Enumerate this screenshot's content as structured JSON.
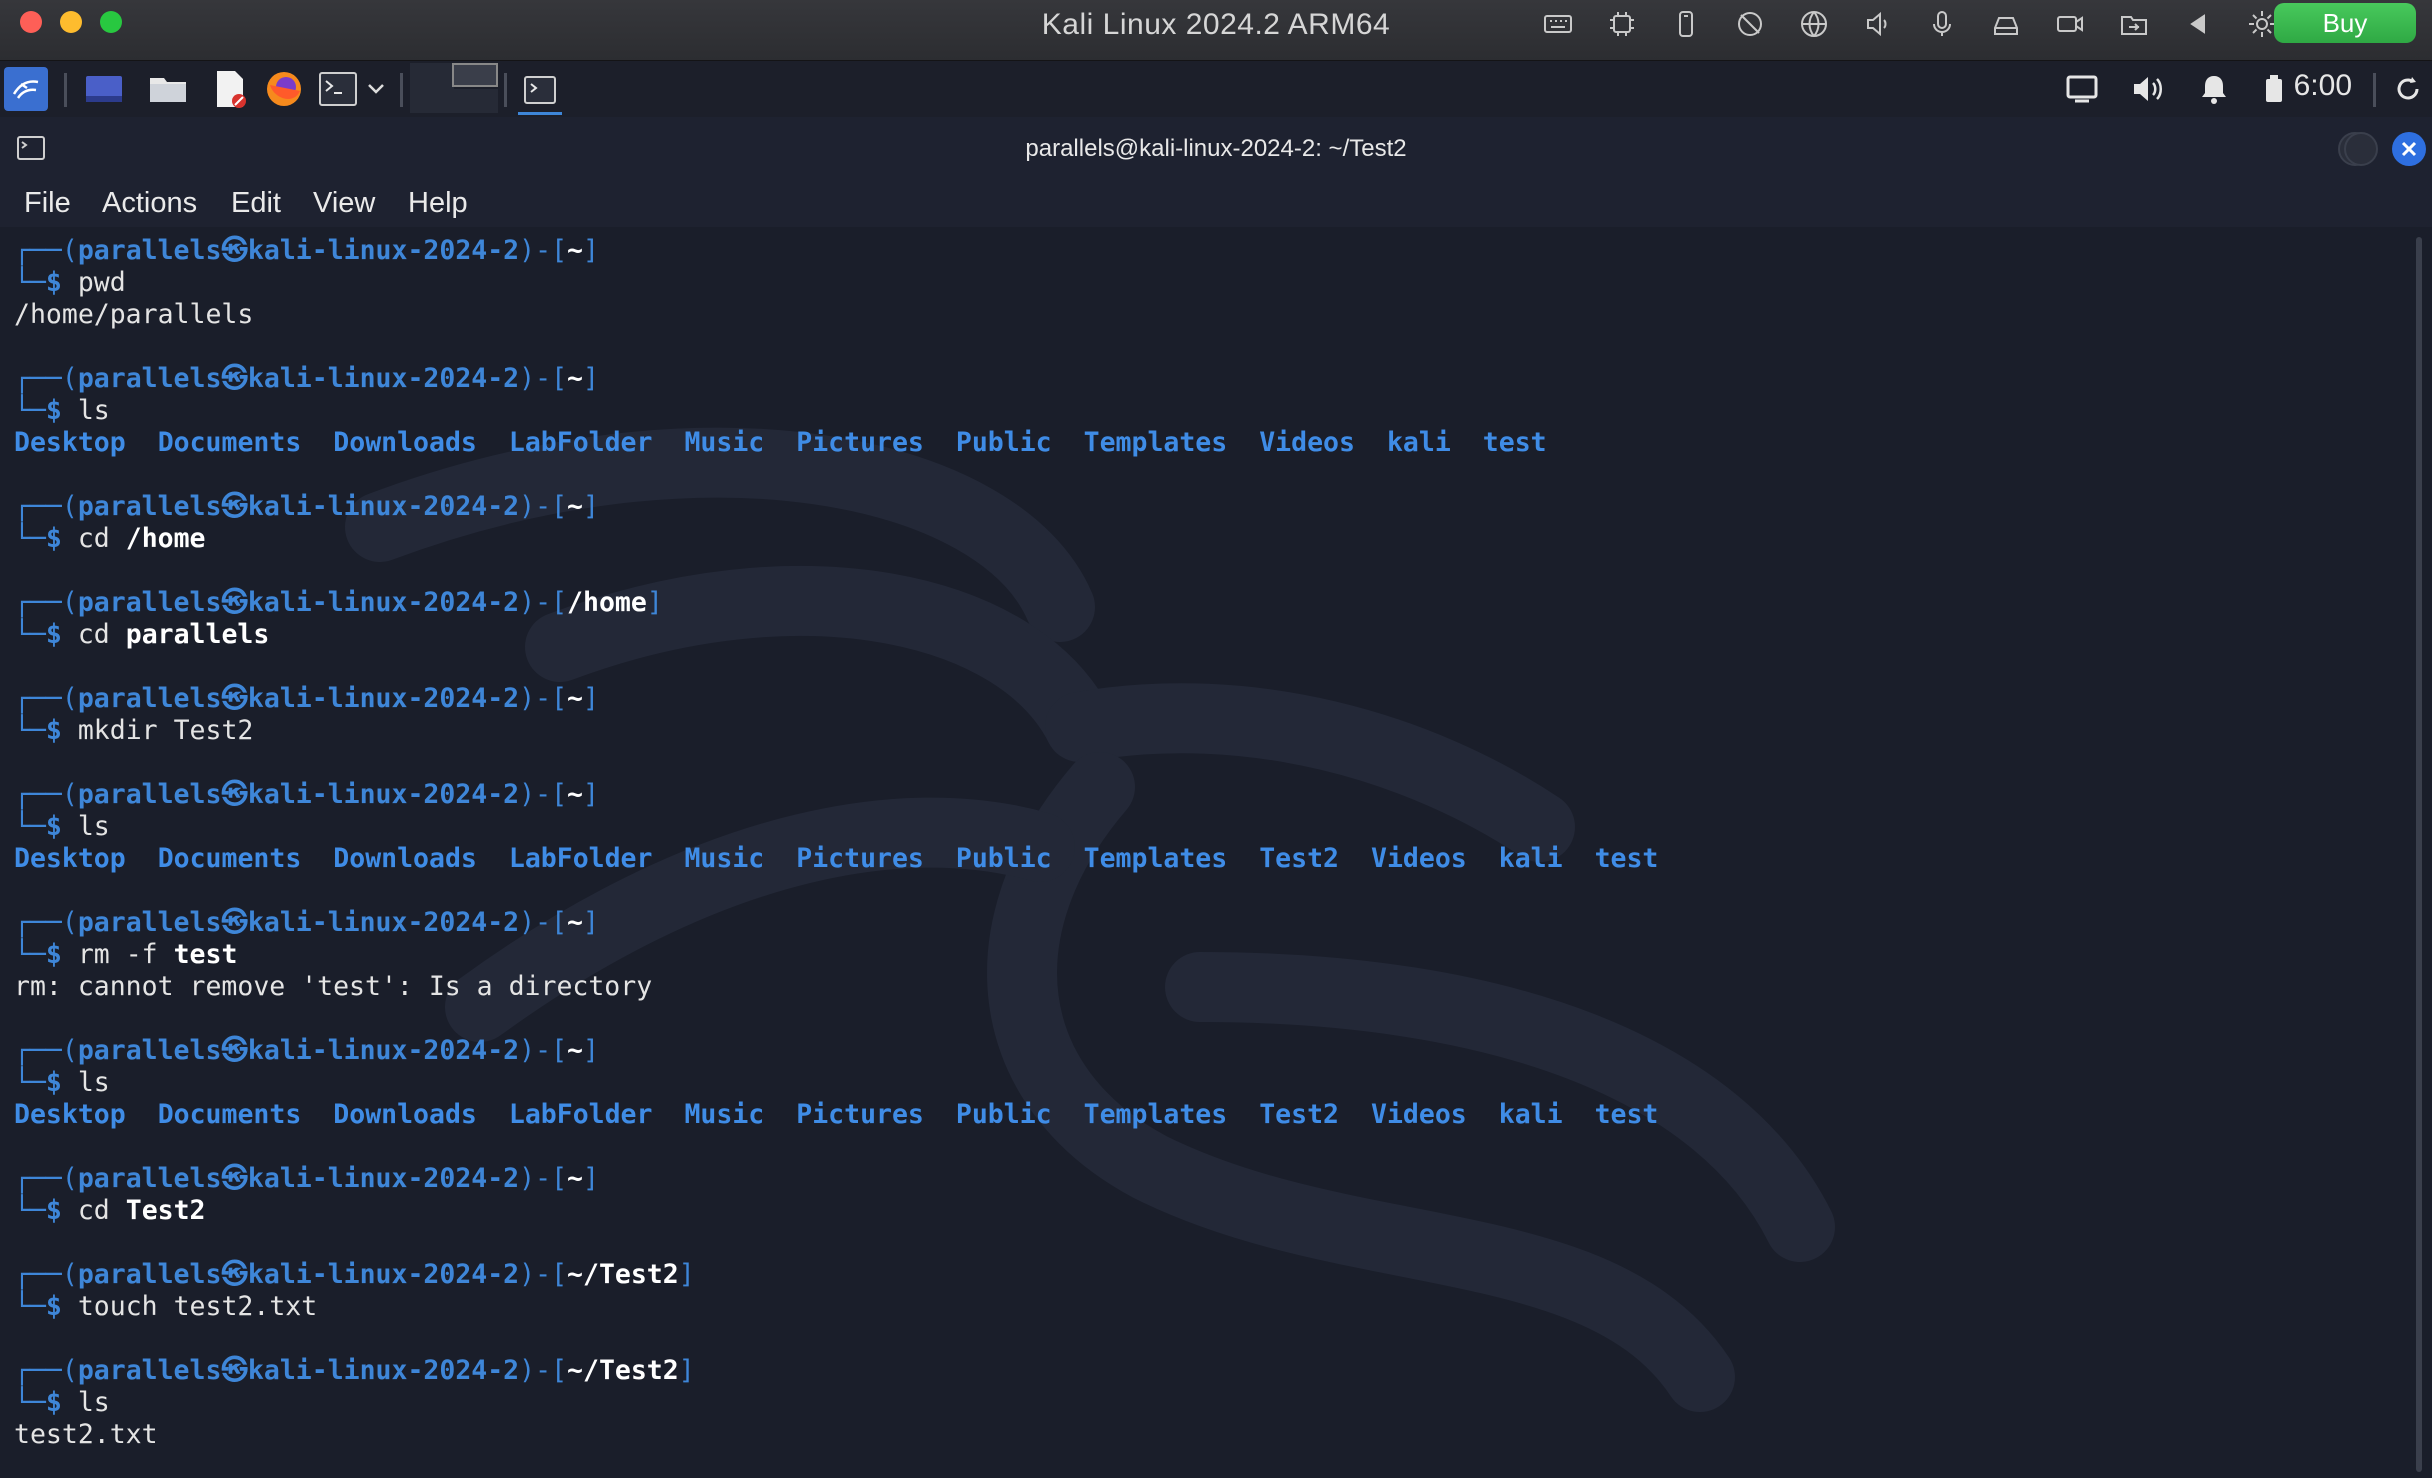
{
  "mac": {
    "title": "Kali Linux 2024.2 ARM64",
    "buy_label": "Buy",
    "icons": [
      "keyboard-icon",
      "cpu-icon",
      "usb-icon",
      "camera-off-icon",
      "globe-icon",
      "speaker-icon",
      "microphone-icon",
      "drive-icon",
      "video-icon",
      "shared-folder-icon",
      "back-arrow-icon",
      "gear-icon"
    ]
  },
  "panel": {
    "clock": "6:00"
  },
  "window": {
    "title": "parallels@kali-linux-2024-2: ~/Test2"
  },
  "menu": [
    "File",
    "Actions",
    "Edit",
    "View",
    "Help"
  ],
  "terminal": {
    "user": "parallels",
    "host": "kali-linux-2024-2",
    "blocks": [
      {
        "path": "~",
        "cmd": "pwd",
        "arg": "",
        "argBold": false,
        "output": [
          "/home/parallels"
        ],
        "ls": null
      },
      {
        "path": "~",
        "cmd": "ls",
        "arg": "",
        "argBold": false,
        "output": [],
        "ls": [
          "Desktop",
          "Documents",
          "Downloads",
          "LabFolder",
          "Music",
          "Pictures",
          "Public",
          "Templates",
          "Videos",
          "kali",
          "test"
        ]
      },
      {
        "path": "~",
        "cmd": "cd",
        "arg": "/home",
        "argBold": true,
        "output": [],
        "ls": null
      },
      {
        "path": "/home",
        "cmd": "cd",
        "arg": "parallels",
        "argBold": true,
        "output": [],
        "ls": null
      },
      {
        "path": "~",
        "cmd": "mkdir",
        "arg": "Test2",
        "argBold": false,
        "output": [],
        "ls": null
      },
      {
        "path": "~",
        "cmd": "ls",
        "arg": "",
        "argBold": false,
        "output": [],
        "ls": [
          "Desktop",
          "Documents",
          "Downloads",
          "LabFolder",
          "Music",
          "Pictures",
          "Public",
          "Templates",
          "Test2",
          "Videos",
          "kali",
          "test"
        ]
      },
      {
        "path": "~",
        "cmd": "rm -f",
        "arg": "test",
        "argBold": true,
        "output": [
          "rm: cannot remove 'test': Is a directory"
        ],
        "ls": null
      },
      {
        "path": "~",
        "cmd": "ls",
        "arg": "",
        "argBold": false,
        "output": [],
        "ls": [
          "Desktop",
          "Documents",
          "Downloads",
          "LabFolder",
          "Music",
          "Pictures",
          "Public",
          "Templates",
          "Test2",
          "Videos",
          "kali",
          "test"
        ]
      },
      {
        "path": "~",
        "cmd": "cd",
        "arg": "Test2",
        "argBold": true,
        "output": [],
        "ls": null
      },
      {
        "path": "~/Test2",
        "cmd": "touch",
        "arg": "test2.txt",
        "argBold": false,
        "output": [],
        "ls": null
      },
      {
        "path": "~/Test2",
        "cmd": "ls",
        "arg": "",
        "argBold": false,
        "output": [
          "test2.txt"
        ],
        "ls": null
      }
    ]
  }
}
